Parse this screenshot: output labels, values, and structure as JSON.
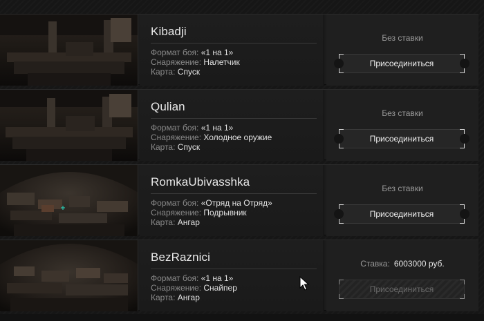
{
  "labels": {
    "format": "Формат боя:",
    "equipment": "Снаряжение:",
    "map": "Карта:",
    "stake": "Ставка:",
    "join": "Присоединиться",
    "no_stake": "Без ставки"
  },
  "matches": [
    {
      "name": "Kibadji",
      "format": "«1 на 1»",
      "equipment": "Налетчик",
      "map": "Спуск",
      "stake_text": "Без ставки",
      "join_label": "Присоединиться",
      "join_enabled": true
    },
    {
      "name": "Qulian",
      "format": "«1 на 1»",
      "equipment": "Холодное оружие",
      "map": "Спуск",
      "stake_text": "Без ставки",
      "join_label": "Присоединиться",
      "join_enabled": true
    },
    {
      "name": "RomkaUbivasshka",
      "format": "«Отряд на Отряд»",
      "equipment": "Подрывник",
      "map": "Ангар",
      "stake_text": "Без ставки",
      "join_label": "Присоединиться",
      "join_enabled": true
    },
    {
      "name": "BezRaznici",
      "format": "«1 на 1»",
      "equipment": "Снайпер",
      "map": "Ангар",
      "stake_label": "Ставка:",
      "stake_amount": "6003000 руб.",
      "join_label": "Присоединиться",
      "join_enabled": false
    }
  ],
  "icons": {
    "cursor": "arrow-cursor-icon",
    "thumbnail": "map-preview-image"
  }
}
